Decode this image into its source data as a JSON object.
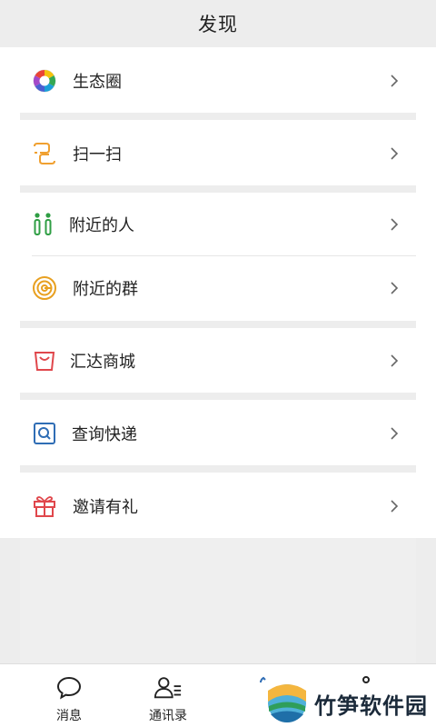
{
  "header": {
    "title": "发现"
  },
  "menu": {
    "items": [
      {
        "label": "生态圈",
        "icon": "ecosystem-aperture-icon"
      },
      {
        "label": "扫一扫",
        "icon": "scan-icon"
      },
      {
        "label": "附近的人",
        "icon": "people-nearby-icon"
      },
      {
        "label": "附近的群",
        "icon": "groups-nearby-icon"
      },
      {
        "label": "汇达商城",
        "icon": "shopping-bag-icon"
      },
      {
        "label": "查询快递",
        "icon": "search-express-icon"
      },
      {
        "label": "邀请有礼",
        "icon": "gift-icon"
      }
    ]
  },
  "tabbar": {
    "tabs": [
      {
        "label": "消息",
        "icon": "chat-bubble-icon"
      },
      {
        "label": "通讯录",
        "icon": "contacts-icon"
      },
      {
        "label": "",
        "icon": "discover-icon"
      },
      {
        "label": "",
        "icon": "me-icon"
      }
    ]
  },
  "watermark": {
    "text": "竹笋软件园"
  },
  "colors": {
    "background": "#ededed",
    "card": "#ffffff",
    "chevron": "#666666",
    "scan_orange": "#f0a030",
    "people_green": "#2f9e44",
    "group_orange": "#e8a020",
    "shop_red": "#e0474c",
    "express_blue": "#2f6db5",
    "gift_red": "#e0474c"
  }
}
